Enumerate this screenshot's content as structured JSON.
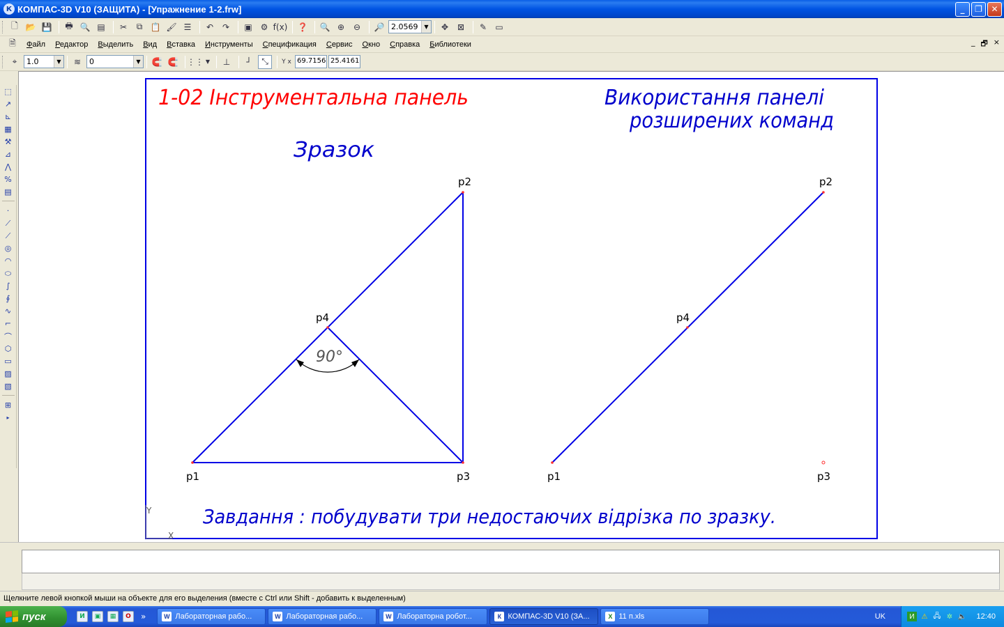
{
  "window": {
    "title": "КОМПАС-3D V10 (ЗАЩИТА) - [Упражнение 1-2.frw]",
    "icon": "К"
  },
  "toolbar": {
    "zoom_value": "2.0569"
  },
  "menu": {
    "items": [
      "Файл",
      "Редактор",
      "Выделить",
      "Вид",
      "Вставка",
      "Инструменты",
      "Спецификация",
      "Сервис",
      "Окно",
      "Справка",
      "Библиотеки"
    ],
    "mdi_minimize": "_",
    "mdi_restore": "🗗",
    "mdi_close": "×"
  },
  "params": {
    "step": "1.0",
    "layer": "0",
    "coord_label": "Y x",
    "x": "69.7156",
    "y": "25.4161"
  },
  "drawing": {
    "title_left": "1-02 Інструментальна панель",
    "title_right_line1": "Використання панелі",
    "title_right_line2": "розширених команд",
    "sample_label": "Зразок",
    "angle_label": "90°",
    "points": {
      "p1": "p1",
      "p2": "p2",
      "p3": "p3",
      "p4": "p4"
    },
    "task_text": "Завдання : побудувати три недостаючих відрізка по зразку.",
    "axis_y": "Y",
    "axis_x": "X",
    "colors": {
      "line": "#0000e6",
      "title_left": "#ff0000",
      "text": "#0000cc",
      "dimension": "#000000"
    }
  },
  "status": {
    "hint": "Щелкните левой кнопкой мыши на объекте для его выделения (вместе с Ctrl или Shift - добавить к выделенным)"
  },
  "taskbar": {
    "start_label": "пуск",
    "tasks": [
      {
        "label": "Лабораторная рабо...",
        "icon": "W"
      },
      {
        "label": "Лабораторная рабо...",
        "icon": "W"
      },
      {
        "label": "Лабораторна робот...",
        "icon": "W"
      },
      {
        "label": "КОМПАС-3D V10 (ЗА...",
        "icon": "К"
      },
      {
        "label": "11 п.xls",
        "icon": "X"
      }
    ],
    "lang": "UK",
    "clock": "12:40"
  }
}
